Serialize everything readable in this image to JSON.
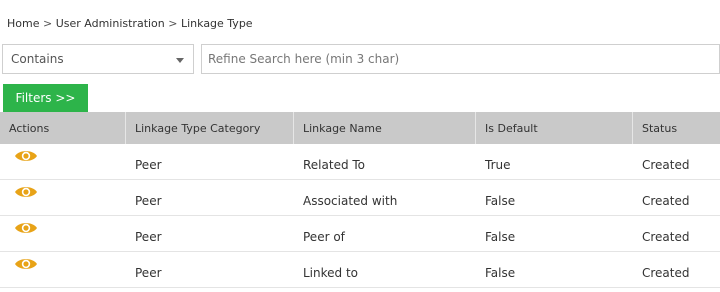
{
  "breadcrumb": {
    "items": [
      "Home",
      "User Administration",
      "Linkage Type"
    ],
    "separator": ">"
  },
  "search": {
    "mode_value": "Contains",
    "placeholder": "Refine Search here (min 3 char)"
  },
  "filters_button": {
    "label": "Filters >>"
  },
  "table": {
    "columns": [
      "Actions",
      "Linkage Type Category",
      "Linkage Name",
      "Is Default",
      "Status"
    ],
    "rows": [
      {
        "action_icon": "eye-icon",
        "category": "Peer",
        "name": "Related To",
        "is_default": "True",
        "status": "Created"
      },
      {
        "action_icon": "eye-icon",
        "category": "Peer",
        "name": "Associated with",
        "is_default": "False",
        "status": "Created"
      },
      {
        "action_icon": "eye-icon",
        "category": "Peer",
        "name": "Peer of",
        "is_default": "False",
        "status": "Created"
      },
      {
        "action_icon": "eye-icon",
        "category": "Peer",
        "name": "Linked to",
        "is_default": "False",
        "status": "Created"
      }
    ]
  },
  "colors": {
    "accent_green": "#2db44a",
    "header_gray": "#c9c9c9",
    "eye_orange": "#e8a317"
  }
}
